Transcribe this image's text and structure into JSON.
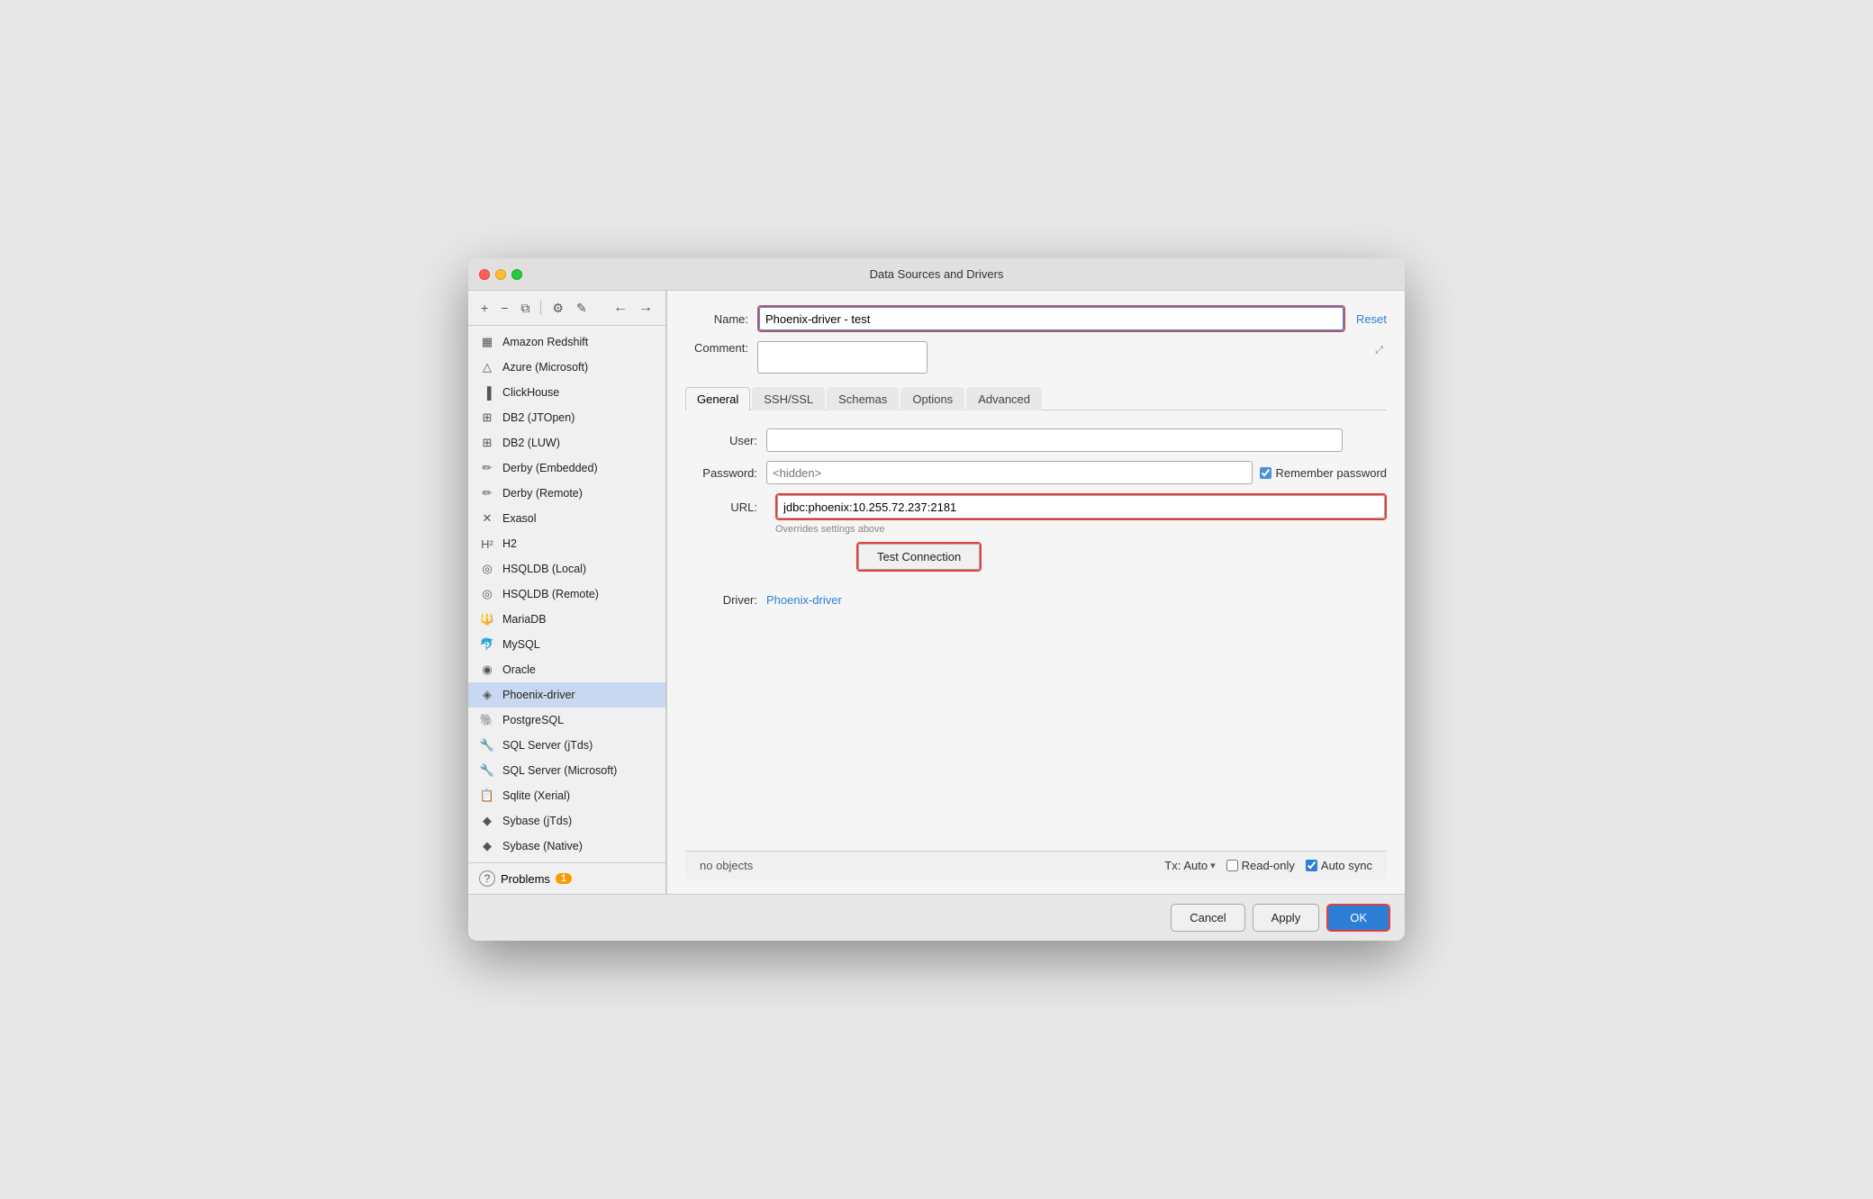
{
  "window": {
    "title": "Data Sources and Drivers"
  },
  "sidebar": {
    "toolbar": {
      "add_label": "+",
      "remove_label": "−",
      "copy_label": "⧉",
      "settings_label": "⚙",
      "edit_label": "✎",
      "back_label": "←",
      "forward_label": "→"
    },
    "items": [
      {
        "id": "amazon-redshift",
        "label": "Amazon Redshift",
        "icon": "▦"
      },
      {
        "id": "azure-microsoft",
        "label": "Azure (Microsoft)",
        "icon": "△"
      },
      {
        "id": "clickhouse",
        "label": "ClickHouse",
        "icon": "▌▌▌"
      },
      {
        "id": "db2-jtopen",
        "label": "DB2 (JTOpen)",
        "icon": "⊞"
      },
      {
        "id": "db2-luw",
        "label": "DB2 (LUW)",
        "icon": "⊞"
      },
      {
        "id": "derby-embedded",
        "label": "Derby (Embedded)",
        "icon": "✏"
      },
      {
        "id": "derby-remote",
        "label": "Derby (Remote)",
        "icon": "✏"
      },
      {
        "id": "exasol",
        "label": "Exasol",
        "icon": "✕"
      },
      {
        "id": "h2",
        "label": "H2",
        "icon": "H2"
      },
      {
        "id": "hsqldb-local",
        "label": "HSQLDB (Local)",
        "icon": "○"
      },
      {
        "id": "hsqldb-remote",
        "label": "HSQLDB (Remote)",
        "icon": "○"
      },
      {
        "id": "mariadb",
        "label": "MariaDB",
        "icon": "🔱"
      },
      {
        "id": "mysql",
        "label": "MySQL",
        "icon": "🐬"
      },
      {
        "id": "oracle",
        "label": "Oracle",
        "icon": "◎"
      },
      {
        "id": "phoenix-driver",
        "label": "Phoenix-driver",
        "icon": "🔥",
        "active": true
      },
      {
        "id": "postgresql",
        "label": "PostgreSQL",
        "icon": "🐘"
      },
      {
        "id": "sql-server-jtds",
        "label": "SQL Server (jTds)",
        "icon": "🔧"
      },
      {
        "id": "sql-server-microsoft",
        "label": "SQL Server (Microsoft)",
        "icon": "🔧"
      },
      {
        "id": "sqlite-xerial",
        "label": "Sqlite (Xerial)",
        "icon": "📋"
      },
      {
        "id": "sybase-jtds",
        "label": "Sybase (jTds)",
        "icon": "🔶"
      },
      {
        "id": "sybase-native",
        "label": "Sybase (Native)",
        "icon": "🔶"
      }
    ],
    "footer": {
      "problems_label": "Problems",
      "problems_count": "1"
    }
  },
  "detail": {
    "name_label": "Name:",
    "name_value": "Phoenix-driver - test",
    "comment_label": "Comment:",
    "reset_label": "Reset",
    "tabs": [
      {
        "id": "general",
        "label": "General",
        "active": true
      },
      {
        "id": "ssh-ssl",
        "label": "SSH/SSL"
      },
      {
        "id": "schemas",
        "label": "Schemas"
      },
      {
        "id": "options",
        "label": "Options"
      },
      {
        "id": "advanced",
        "label": "Advanced"
      }
    ],
    "form": {
      "user_label": "User:",
      "user_value": "",
      "password_label": "Password:",
      "password_placeholder": "<hidden>",
      "remember_password_label": "Remember password",
      "url_label": "URL:",
      "url_value": "jdbc:phoenix:10.255.72.237:2181",
      "overrides_note": "Overrides settings above",
      "test_connection_label": "Test Connection",
      "driver_label": "Driver:",
      "driver_value": "Phoenix-driver"
    }
  },
  "status_bar": {
    "no_objects_label": "no objects",
    "tx_label": "Tx:",
    "tx_value": "Auto",
    "readonly_label": "Read-only",
    "autosync_label": "Auto sync"
  },
  "footer": {
    "cancel_label": "Cancel",
    "apply_label": "Apply",
    "ok_label": "OK"
  }
}
